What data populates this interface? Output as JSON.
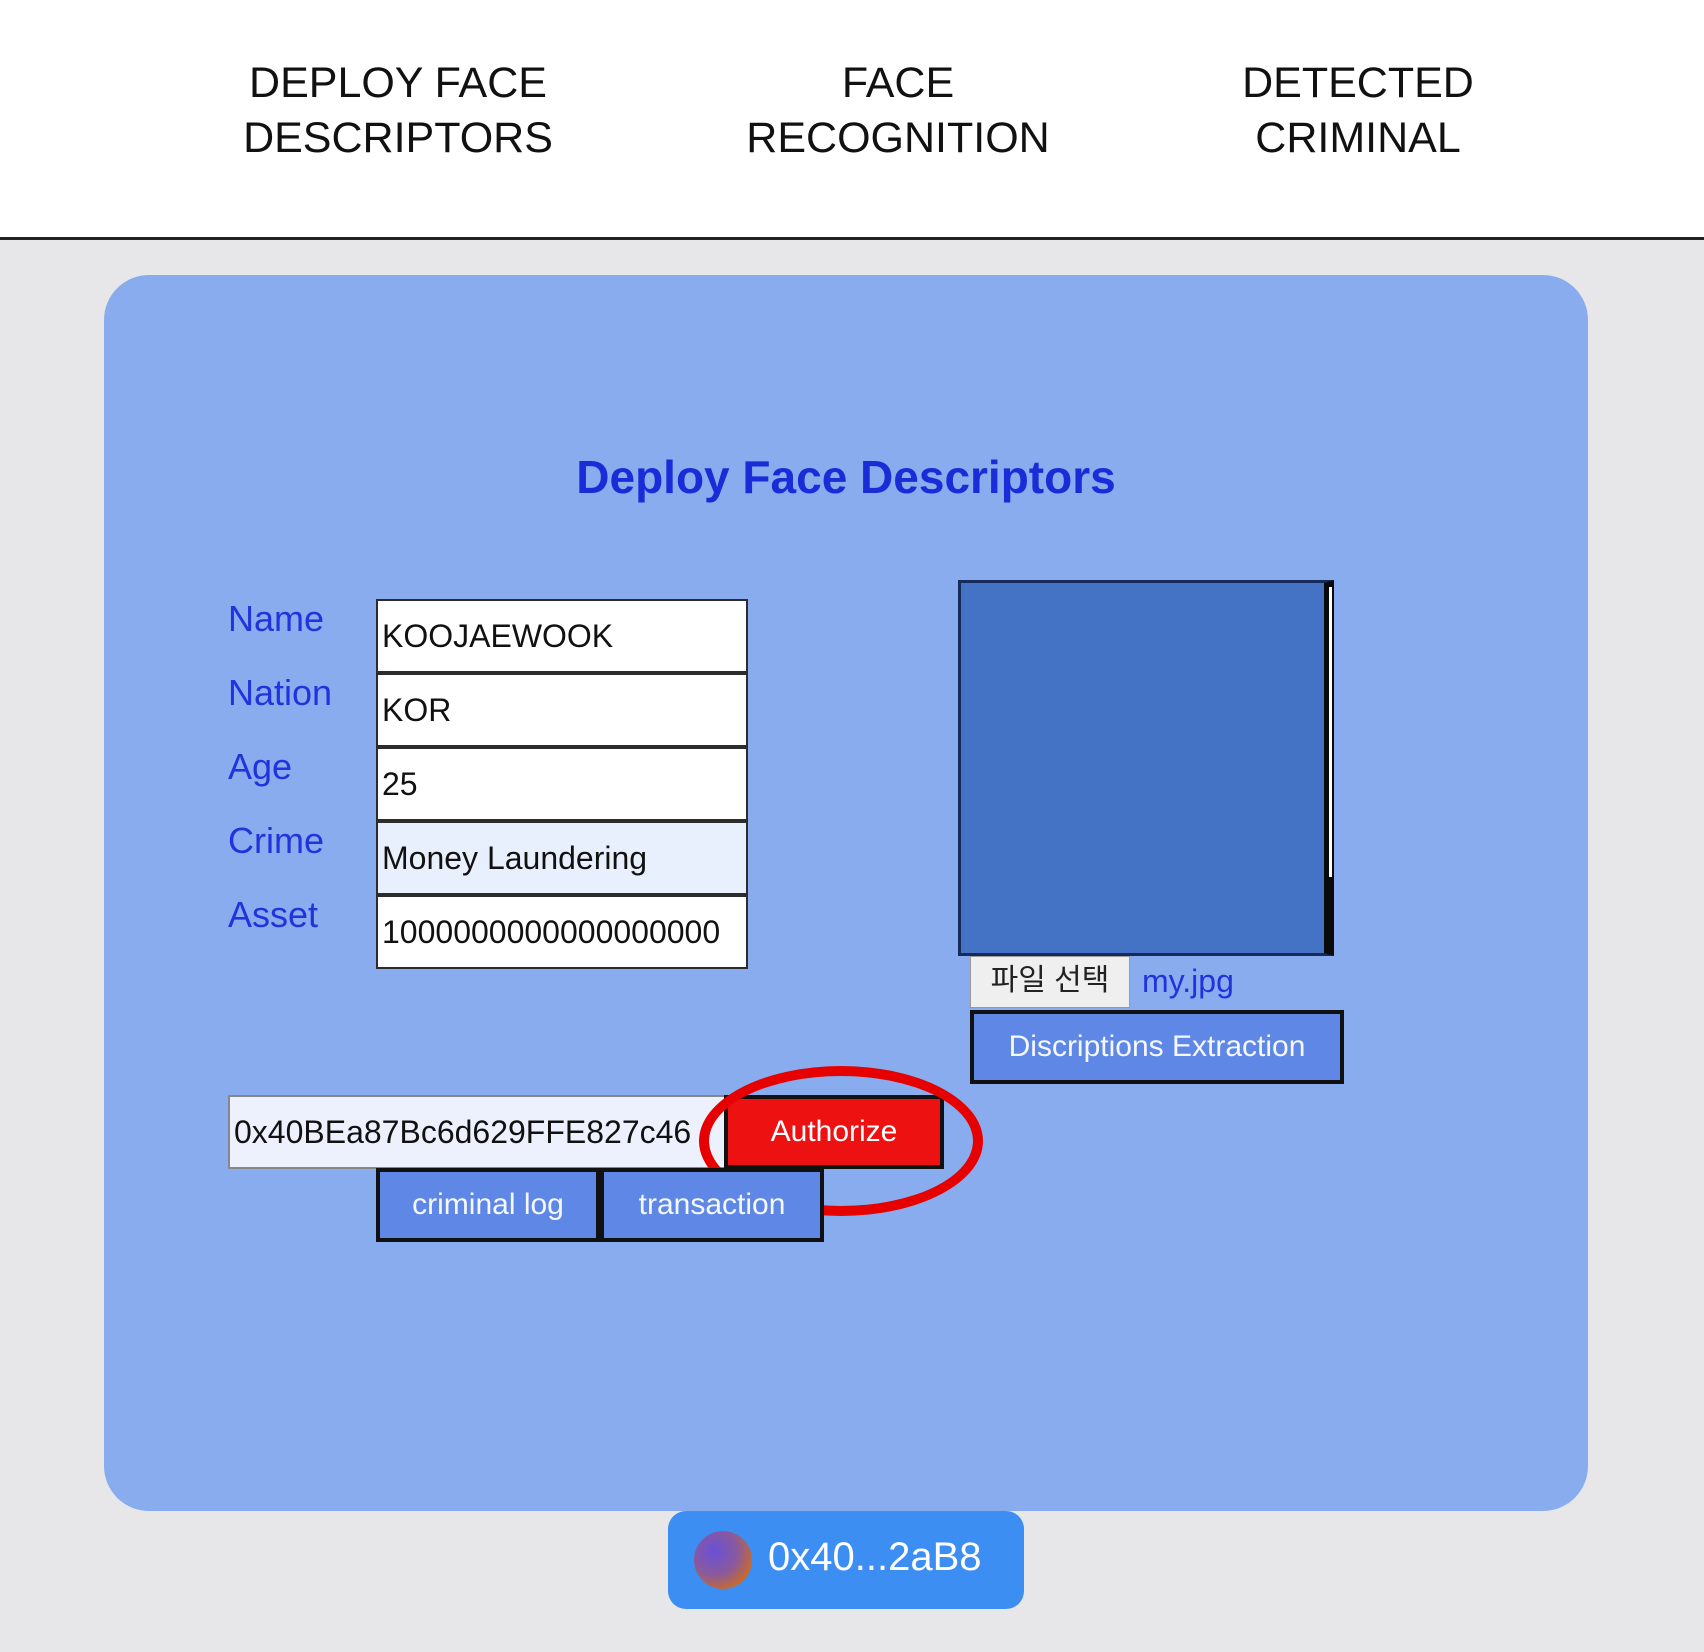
{
  "nav": {
    "items": [
      {
        "label": "DEPLOY FACE\nDESCRIPTORS"
      },
      {
        "label": "FACE\nRECOGNITION"
      },
      {
        "label": "DETECTED\nCRIMINAL"
      }
    ]
  },
  "panel": {
    "title": "Deploy Face Descriptors",
    "fields": [
      {
        "label": "Name",
        "value": "KOOJAEWOOK"
      },
      {
        "label": "Nation",
        "value": "KOR"
      },
      {
        "label": "Age",
        "value": "25"
      },
      {
        "label": "Crime",
        "value": "Money Laundering"
      },
      {
        "label": "Asset",
        "value": "1000000000000000000"
      }
    ],
    "file_button_label": "파일 선택",
    "file_name": "my.jpg",
    "extract_button_label": "Discriptions Extraction",
    "address_value": "0x40BEa87Bc6d629FFE827c46",
    "authorize_label": "Authorize",
    "criminal_log_label": "criminal log",
    "transaction_label": "transaction"
  },
  "wallet": {
    "address": "0x40...2aB8"
  },
  "colors": {
    "panel_bg": "#88acee",
    "title": "#1a2cd8",
    "authorize_bg": "#ee1111",
    "annotation": "#e60000",
    "wallet_bg": "#3d8ef3"
  }
}
